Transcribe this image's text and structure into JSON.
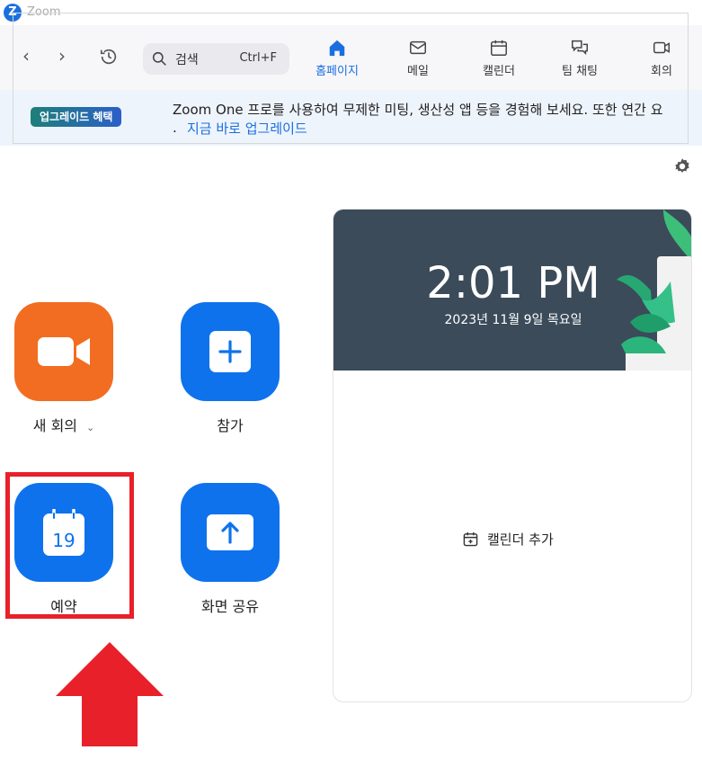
{
  "window": {
    "title": "Zoom",
    "logo_letter": "Z"
  },
  "toolbar": {
    "back_glyph": "‹",
    "forward_glyph": "›",
    "history_icon": "history-icon",
    "search": {
      "label": "검색",
      "shortcut": "Ctrl+F"
    },
    "tabs": [
      {
        "label": "홈페이지",
        "icon": "home-icon",
        "active": true
      },
      {
        "label": "메일",
        "icon": "mail-icon",
        "active": false
      },
      {
        "label": "캘린더",
        "icon": "calendar-icon",
        "active": false
      },
      {
        "label": "팀 채팅",
        "icon": "chat-icon",
        "active": false
      },
      {
        "label": "회의",
        "icon": "video-icon",
        "active": false
      }
    ]
  },
  "banner": {
    "badge": "업그레이드 혜택",
    "text": "Zoom One 프로를 사용하여 무제한 미팅, 생산성 앱 등을 경험해 보세요. 또한 연간 요",
    "dot": ".",
    "link": "지금 바로 업그레이드"
  },
  "actions": {
    "new_meeting": {
      "label": "새 회의",
      "icon": "video-camera-icon",
      "chevron": "⌄"
    },
    "join": {
      "label": "참가",
      "icon": "plus-icon"
    },
    "schedule": {
      "label": "예약",
      "icon": "calendar-icon",
      "day": "19"
    },
    "share_screen": {
      "label": "화면 공유",
      "icon": "upload-arrow-icon"
    }
  },
  "clock": {
    "time": "2:01 PM",
    "date": "2023년 11월 9일 목요일"
  },
  "calendar_card": {
    "add_label": "캘린더 추가"
  },
  "colors": {
    "accent": "#0e72ed",
    "orange": "#f26d21",
    "highlight": "#e8202a",
    "card_header": "#3b4b5a"
  }
}
